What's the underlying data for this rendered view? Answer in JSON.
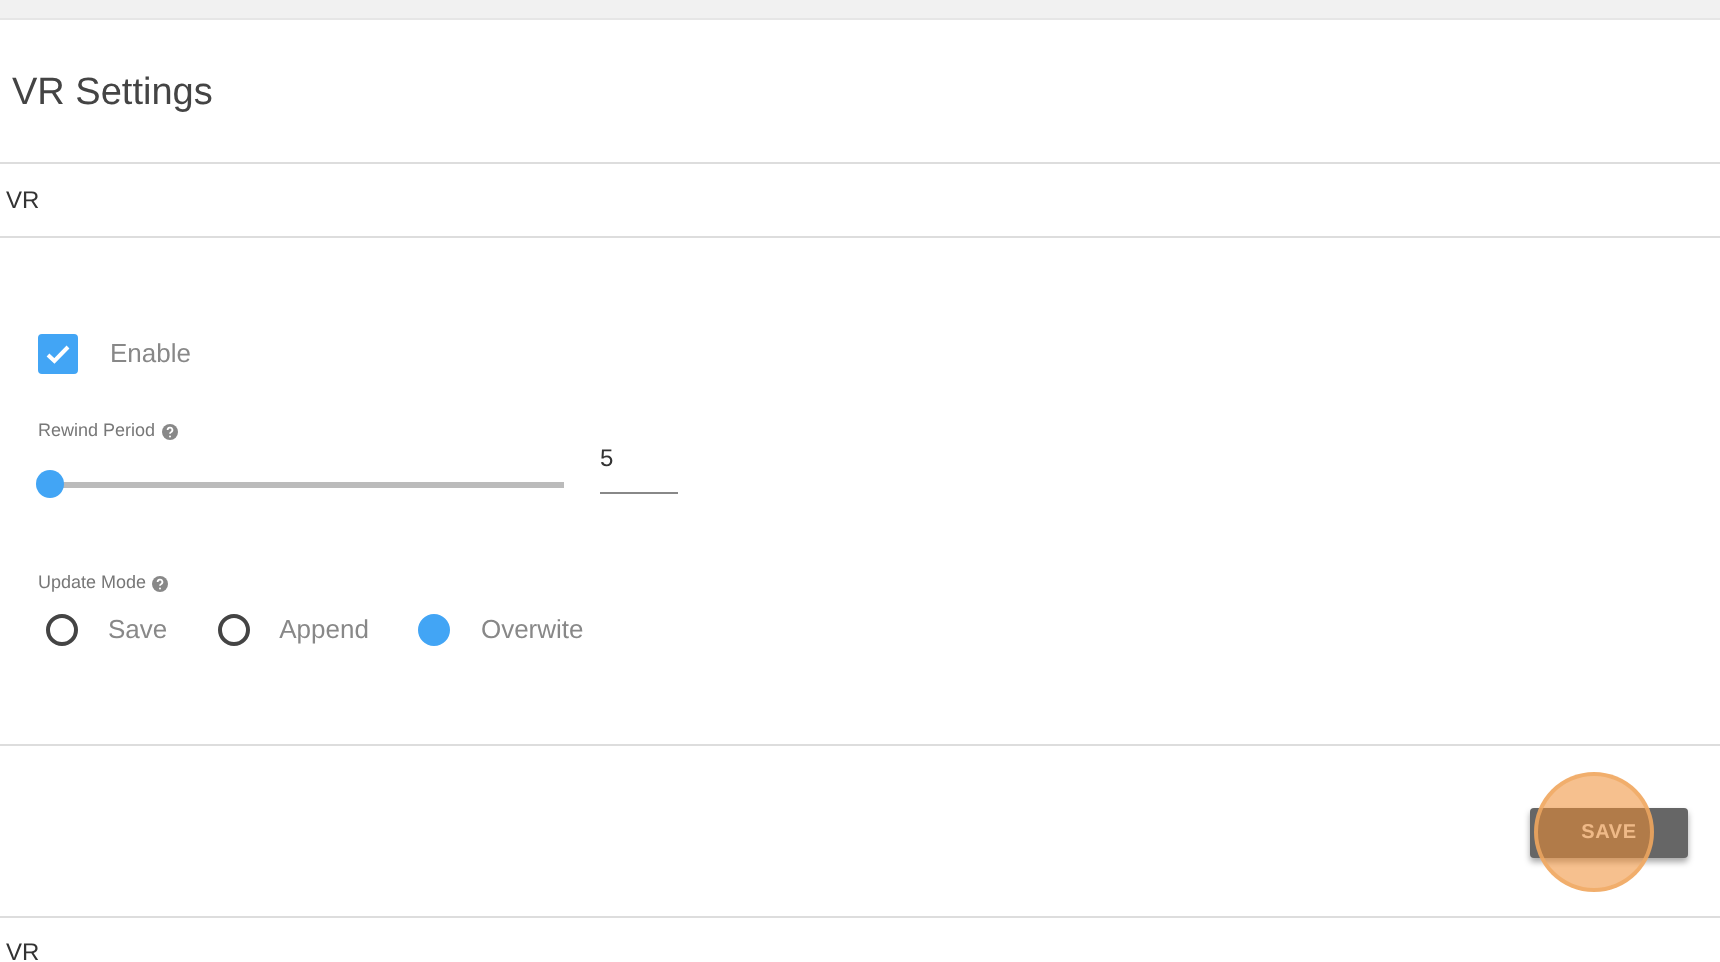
{
  "title": "VR Settings",
  "section": "VR",
  "enable": {
    "label": "Enable",
    "checked": true
  },
  "rewind_period": {
    "label": "Rewind Period",
    "level": 0.02,
    "value": "5"
  },
  "update_mode": {
    "label": "Update Mode",
    "options": [
      {
        "label": "Save",
        "selected": false
      },
      {
        "label": "Append",
        "selected": false
      },
      {
        "label": "Overwite",
        "selected": true
      }
    ]
  },
  "save_button": "SAVE",
  "next_section": "VR"
}
